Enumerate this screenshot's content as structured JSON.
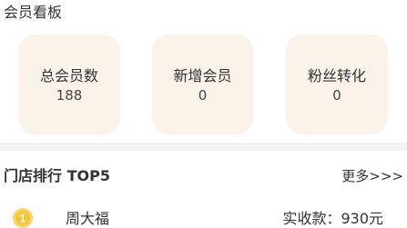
{
  "member_board": {
    "title": "会员看板",
    "cards": [
      {
        "label": "总会员数",
        "value": "188"
      },
      {
        "label": "新增会员",
        "value": "0"
      },
      {
        "label": "粉丝转化",
        "value": "0"
      }
    ]
  },
  "store_ranking": {
    "title": "门店排行 TOP5",
    "more_label": "更多>>>",
    "rows": [
      {
        "rank": "1",
        "name": "周大福",
        "income": "实收款：930元"
      }
    ]
  },
  "colors": {
    "card_bg": "#fbf2ea",
    "medal": "#f5c542",
    "page_bg": "#f2f2f2"
  }
}
